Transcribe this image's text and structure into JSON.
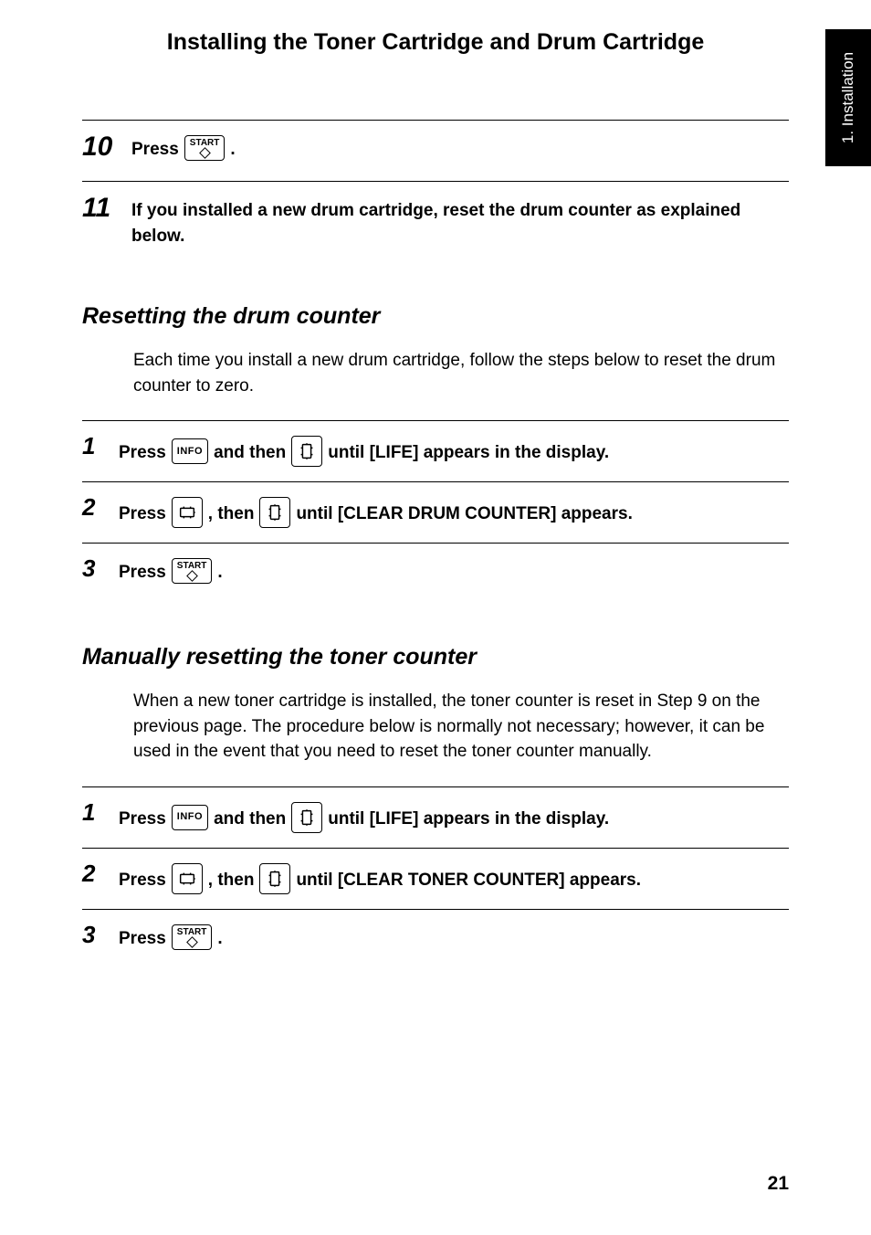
{
  "sideTab": "1. Installation",
  "pageTitle": "Installing the Toner Cartridge and Drum Cartridge",
  "top": {
    "step10": {
      "num": "10",
      "pre": "Press ",
      "keyTop": "START",
      "post": "."
    },
    "step11": {
      "num": "11",
      "text": "If you installed a new drum cartridge, reset the drum counter as explained below."
    }
  },
  "sectionA": {
    "heading": "Resetting the drum counter",
    "intro": "Each time you install a new drum cartridge, follow the steps below to reset the drum counter to zero.",
    "s1": {
      "num": "1",
      "p1": "Press ",
      "info": "INFO",
      "p2": " and then ",
      "p3": " until [LIFE] appears in the display."
    },
    "s2": {
      "num": "2",
      "p1": "Press ",
      "p2": ", then ",
      "p3": " until [CLEAR DRUM COUNTER] appears."
    },
    "s3": {
      "num": "3",
      "p1": "Press ",
      "keyTop": "START",
      "p2": "."
    }
  },
  "sectionB": {
    "heading": "Manually resetting the toner counter",
    "intro": "When a new toner cartridge is installed, the toner counter is reset in Step 9 on the previous page. The procedure below is normally not necessary; however, it can be used in the event that you need to reset the toner counter manually.",
    "s1": {
      "num": "1",
      "p1": "Press ",
      "info": "INFO",
      "p2": " and then ",
      "p3": " until [LIFE] appears in the display."
    },
    "s2": {
      "num": "2",
      "p1": "Press ",
      "p2": ", then ",
      "p3": " until [CLEAR TONER COUNTER] appears."
    },
    "s3": {
      "num": "3",
      "p1": "Press ",
      "keyTop": "START",
      "p2": "."
    }
  },
  "pageNumber": "21"
}
